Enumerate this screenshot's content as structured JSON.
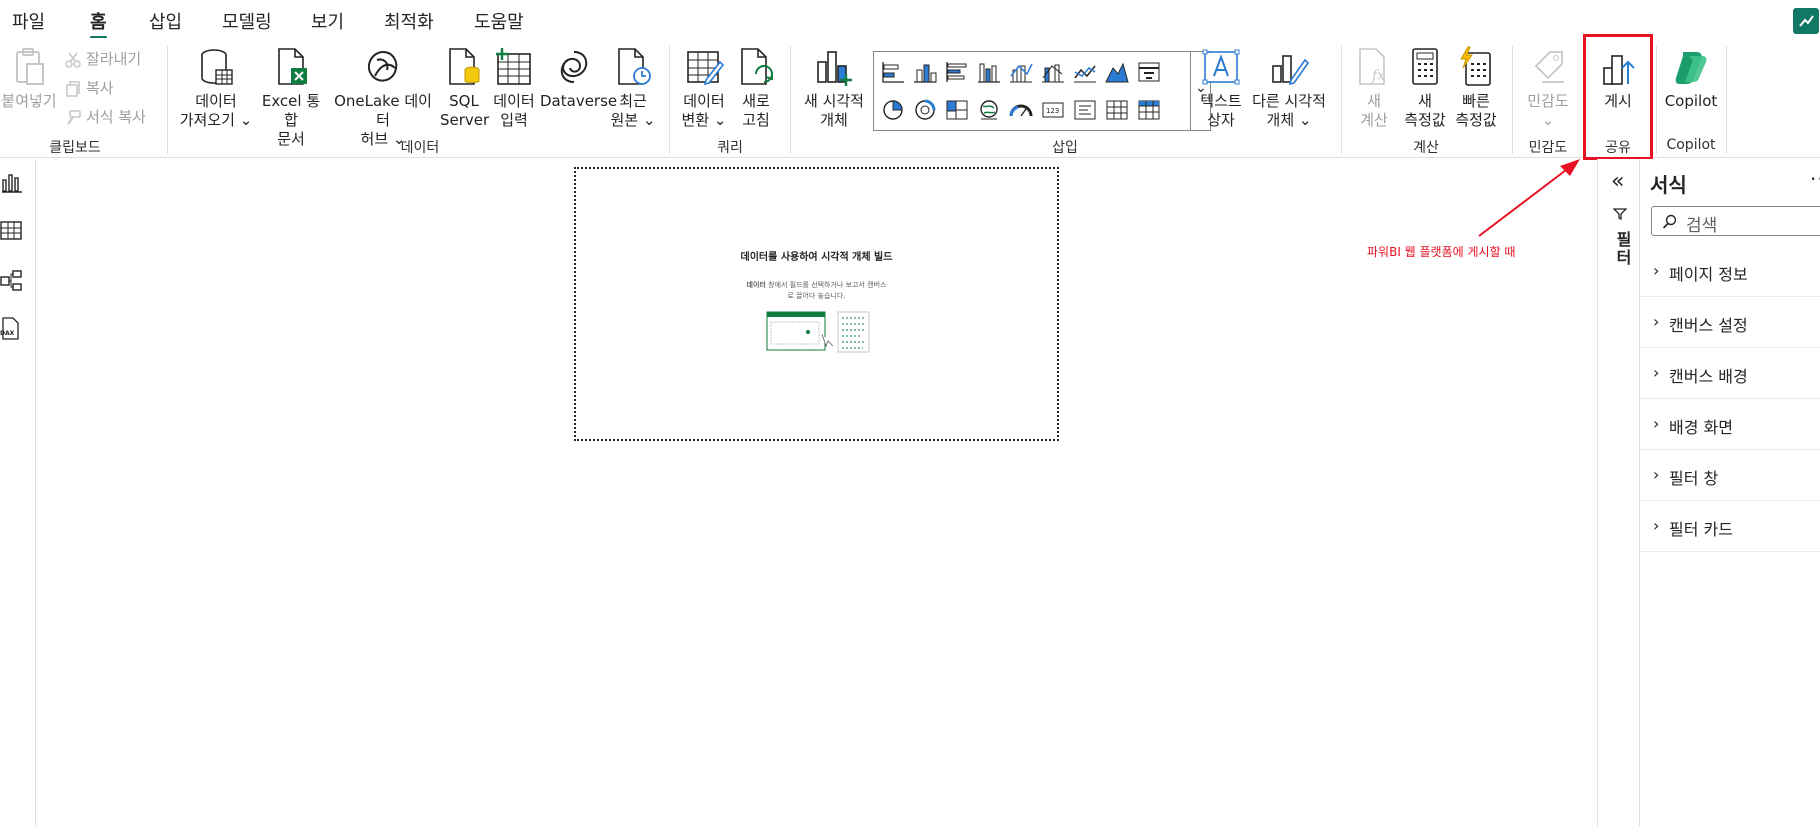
{
  "menu": {
    "tabs": [
      "파일",
      "홈",
      "삽입",
      "모델링",
      "보기",
      "최적화",
      "도움말"
    ],
    "active_tab": "홈"
  },
  "ribbon": {
    "clipboard": {
      "paste": "붙여넣기",
      "cut": "잘라내기",
      "copy": "복사",
      "format_painter": "서식 복사",
      "group_label": "클립보드"
    },
    "data": {
      "get_data_l1": "데이터",
      "get_data_l2": "가져오기",
      "excel_l1": "Excel 통합",
      "excel_l2": "문서",
      "onelake_l1": "OneLake 데이터",
      "onelake_l2": "허브",
      "sql_l1": "SQL",
      "sql_l2": "Server",
      "enter_data_l1": "데이터",
      "enter_data_l2": "입력",
      "dataverse": "Dataverse",
      "recent_l1": "최근",
      "recent_l2": "원본",
      "group_label": "데이터"
    },
    "query": {
      "transform_l1": "데이터",
      "transform_l2": "변환",
      "refresh_l1": "새로",
      "refresh_l2": "고침",
      "group_label": "쿼리"
    },
    "insert": {
      "new_visual_l1": "새 시각적",
      "new_visual_l2": "개체",
      "textbox_l1": "텍스트",
      "textbox_l2": "상자",
      "more_visuals_l1": "다른 시각적",
      "more_visuals_l2": "개체",
      "group_label": "삽입"
    },
    "calc": {
      "new_calc_l1": "새",
      "new_calc_l2": "계산",
      "new_measure_l1": "새",
      "new_measure_l2": "측정값",
      "quick_measure_l1": "빠른",
      "quick_measure_l2": "측정값",
      "group_label": "계산"
    },
    "sensitivity": {
      "label": "민감도",
      "group_label": "민감도"
    },
    "share": {
      "publish": "게시",
      "group_label": "공유"
    },
    "copilot": {
      "label": "Copilot",
      "group_label": "Copilot"
    }
  },
  "canvas": {
    "title": "데이터를 사용하여 시각적 개체 빌드",
    "desc_bold": "데이터",
    "desc": " 창에서 필드를 선택하거나 보고서 캔버스로 끌어다 놓습니다."
  },
  "annotation": "파워BI 웹 플랫폼에 게시할 때",
  "filter_pane": {
    "label": "필터"
  },
  "format_pane": {
    "title": "서식",
    "more": "···",
    "search_placeholder": "검색",
    "sections": [
      "페이지 정보",
      "캔버스 설정",
      "캔버스 배경",
      "배경 화면",
      "필터 창",
      "필터 카드"
    ]
  },
  "colors": {
    "accent": "#117865",
    "annotation_red": "#e81123",
    "excel_green": "#107c41",
    "icon_blue": "#2b7cd3"
  }
}
